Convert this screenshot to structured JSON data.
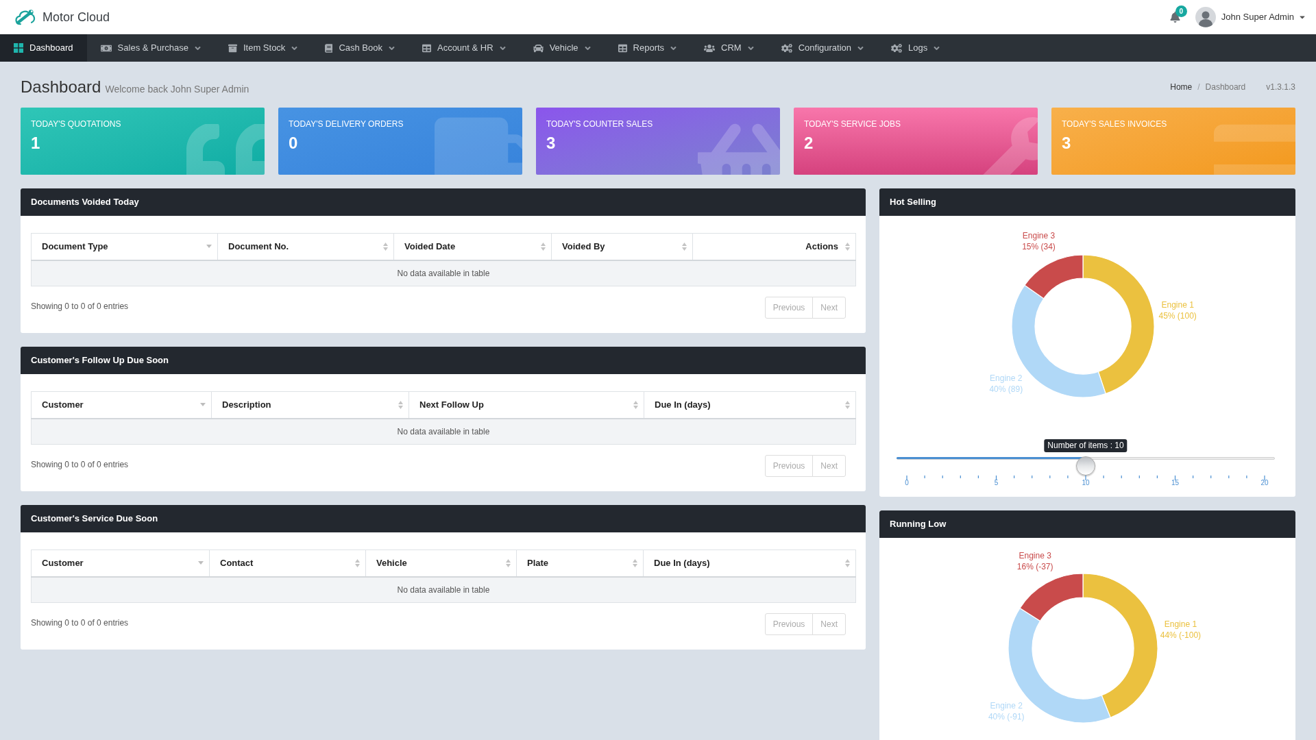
{
  "header": {
    "brand": "Motor Cloud",
    "notification_count": "0",
    "user_name": "John Super Admin"
  },
  "nav": [
    {
      "label": "Dashboard",
      "selected": true,
      "dropdown": false
    },
    {
      "label": "Sales & Purchase",
      "selected": false,
      "dropdown": true
    },
    {
      "label": "Item Stock",
      "selected": false,
      "dropdown": true
    },
    {
      "label": "Cash Book",
      "selected": false,
      "dropdown": true
    },
    {
      "label": "Account & HR",
      "selected": false,
      "dropdown": true
    },
    {
      "label": "Vehicle",
      "selected": false,
      "dropdown": true
    },
    {
      "label": "Reports",
      "selected": false,
      "dropdown": true
    },
    {
      "label": "CRM",
      "selected": false,
      "dropdown": true
    },
    {
      "label": "Configuration",
      "selected": false,
      "dropdown": true
    },
    {
      "label": "Logs",
      "selected": false,
      "dropdown": true
    }
  ],
  "page": {
    "title": "Dashboard",
    "subtitle": "Welcome back John Super Admin",
    "breadcrumb": [
      {
        "label": "Home",
        "selected": false
      },
      {
        "label": "Dashboard",
        "selected": true
      }
    ],
    "breadcrumb_separator": "/",
    "version": "v1.3.1.3"
  },
  "stats": [
    {
      "kind": "quotations",
      "label": "TODAY'S QUOTATIONS",
      "value": "1"
    },
    {
      "kind": "delivery",
      "label": "TODAY'S DELIVERY ORDERS",
      "value": "0"
    },
    {
      "kind": "sales",
      "label": "TODAY'S COUNTER SALES",
      "value": "3"
    },
    {
      "kind": "service",
      "label": "TODAY'S SERVICE JOBS",
      "value": "2"
    },
    {
      "kind": "invoices",
      "label": "TODAY'S SALES INVOICES",
      "value": "3"
    }
  ],
  "tables": [
    {
      "title": "Documents Voided Today",
      "columns": [
        {
          "label": "Document Type",
          "sorted": true
        },
        {
          "label": "Document No.",
          "sorted": false
        },
        {
          "label": "Voided Date",
          "sorted": false
        },
        {
          "label": "Voided By",
          "sorted": false
        },
        {
          "label": "Actions",
          "sorted": false
        }
      ],
      "empty_text": "No data available in table",
      "info": "Showing 0 to 0 of 0 entries",
      "pagination": [
        {
          "label": "Previous",
          "disabled": true
        },
        {
          "label": "Next",
          "disabled": true
        }
      ]
    },
    {
      "title": "Customer's Follow Up Due Soon",
      "columns": [
        {
          "label": "Customer",
          "sorted": true
        },
        {
          "label": "Description",
          "sorted": false
        },
        {
          "label": "Next Follow Up",
          "sorted": false
        },
        {
          "label": "Due In (days)",
          "sorted": false
        }
      ],
      "empty_text": "No data available in table",
      "info": "Showing 0 to 0 of 0 entries",
      "pagination": [
        {
          "label": "Previous",
          "disabled": true
        },
        {
          "label": "Next",
          "disabled": true
        }
      ]
    },
    {
      "title": "Customer's Service Due Soon",
      "columns": [
        {
          "label": "Customer",
          "sorted": true
        },
        {
          "label": "Contact",
          "sorted": false
        },
        {
          "label": "Vehicle",
          "sorted": false
        },
        {
          "label": "Plate",
          "sorted": false
        },
        {
          "label": "Due In (days)",
          "sorted": false
        }
      ],
      "empty_text": "No data available in table",
      "info": "Showing 0 to 0 of 0 entries",
      "pagination": [
        {
          "label": "Previous",
          "disabled": true
        },
        {
          "label": "Next",
          "disabled": true
        }
      ]
    }
  ],
  "hot_selling": {
    "title": "Hot Selling",
    "chart_data": {
      "type": "donut",
      "categories": [
        "Engine 1",
        "Engine 2",
        "Engine 3"
      ],
      "values": [
        100,
        89,
        34
      ],
      "colors": [
        "#ebc13f",
        "#b0d8f7",
        "#c94b4b"
      ],
      "value_labels": [
        "45% (100)",
        "40% (89)",
        "15% (34)"
      ]
    },
    "slider": {
      "tooltip": "Number of items : 10",
      "level": 0.5,
      "tick_labels": [
        "0",
        "5",
        "10",
        "15",
        "20"
      ]
    }
  },
  "running_low": {
    "title": "Running Low",
    "chart_data": {
      "type": "donut",
      "categories": [
        "Engine 1",
        "Engine 2",
        "Engine 3"
      ],
      "values": [
        44,
        40,
        16
      ],
      "colors": [
        "#ebc13f",
        "#b0d8f7",
        "#c94b4b"
      ],
      "value_labels": [
        "44% (-100)",
        "40% (-91)",
        "16% (-37)"
      ]
    }
  }
}
